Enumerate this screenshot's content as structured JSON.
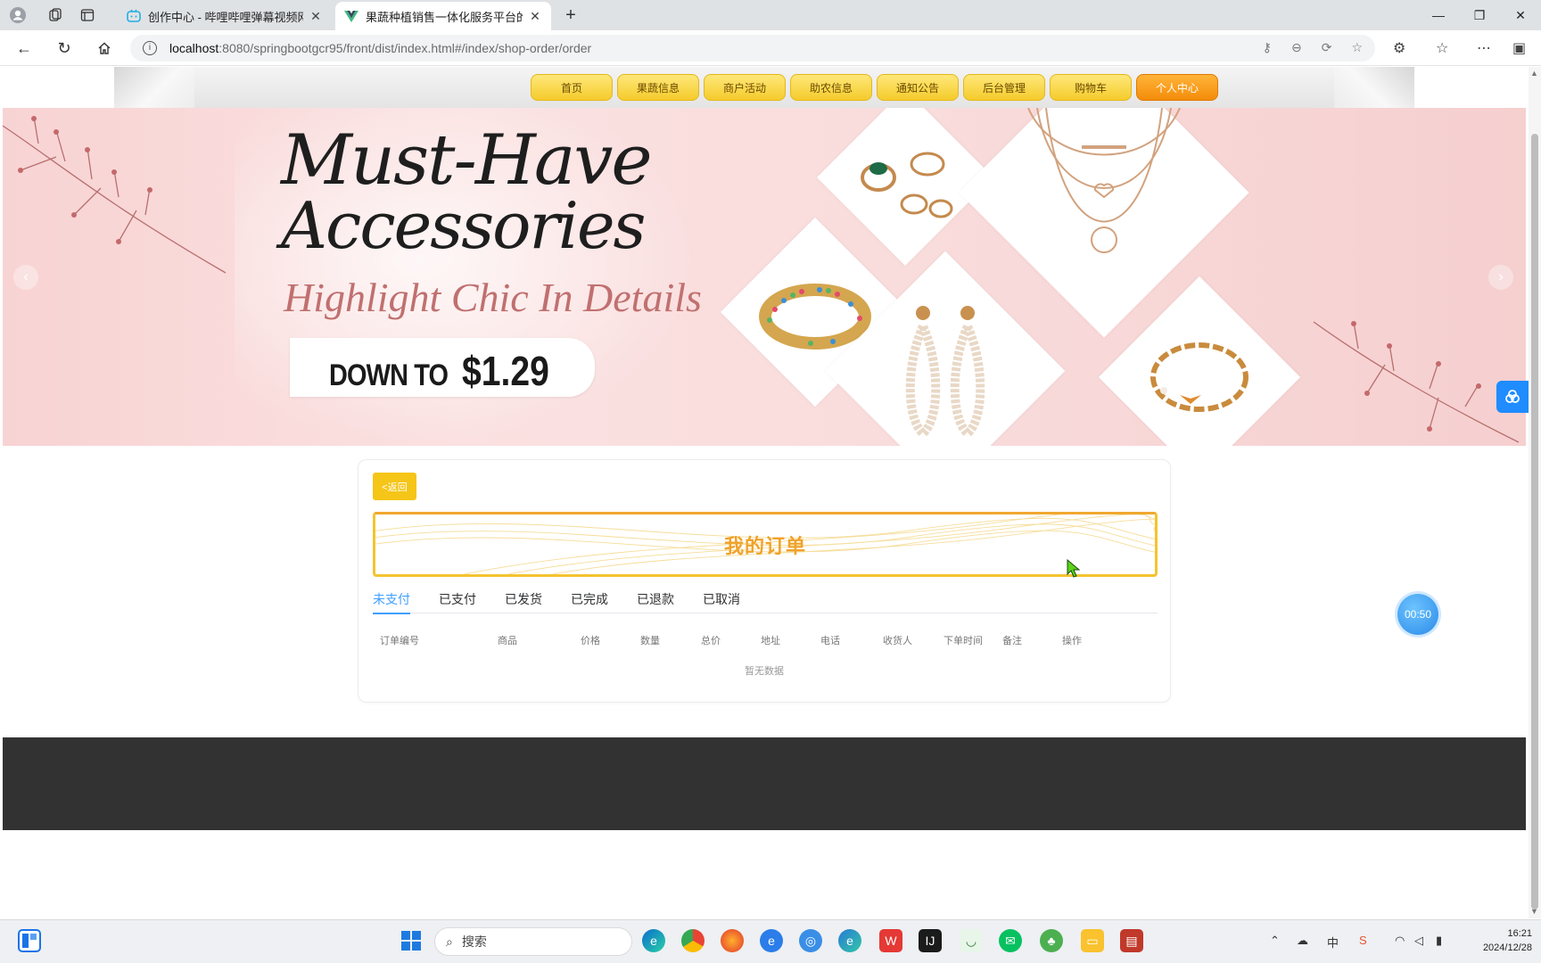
{
  "browser": {
    "tabs": [
      {
        "title": "创作中心 - 哔哩哔哩弹幕视频网",
        "active": false
      },
      {
        "title": "果蔬种植销售一体化服务平台的设计",
        "active": true
      }
    ],
    "url_host": "localhost",
    "url_rest": ":8080/springbootgcr95/front/dist/index.html#/index/shop-order/order"
  },
  "site": {
    "menu": [
      "首页",
      "果蔬信息",
      "商户活动",
      "助农信息",
      "通知公告",
      "后台管理",
      "购物车",
      "个人中心"
    ],
    "current_menu": "个人中心"
  },
  "banner": {
    "headline_1": "Must-Have",
    "headline_2": "Accessories",
    "subtitle": "Highlight Chic In Details",
    "price_prefix": "DOWN TO",
    "price": "$1.29",
    "slide_count": 3,
    "active_slide": 1
  },
  "orders": {
    "back_label": "<返回",
    "title": "我的订单",
    "tabs": [
      "未支付",
      "已支付",
      "已发货",
      "已完成",
      "已退款",
      "已取消"
    ],
    "active_tab": "未支付",
    "columns": [
      "订单编号",
      "商品",
      "价格",
      "数量",
      "总价",
      "地址",
      "电话",
      "收货人",
      "下单时间",
      "备注",
      "操作"
    ],
    "empty_text": "暂无数据"
  },
  "floating": {
    "timer": "00:50"
  },
  "taskbar": {
    "search_placeholder": "搜索",
    "time": "16:21",
    "date": "2024/12/28",
    "ime": "中"
  },
  "colors": {
    "menu_yellow": "#f5cc2c",
    "menu_active": "#f48c0a",
    "accent_orange": "#f0a22a",
    "tab_active": "#409eff",
    "footer": "#323232",
    "banner_pink": "#f8d3d3"
  }
}
